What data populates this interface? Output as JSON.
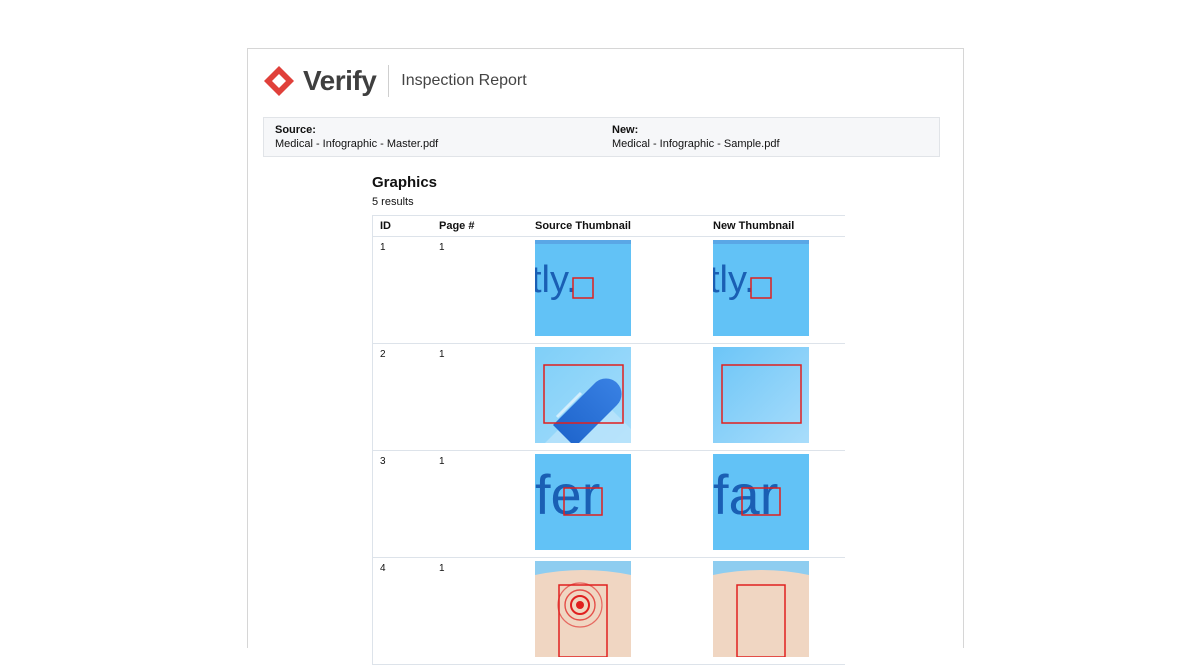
{
  "header": {
    "brand": "Verify",
    "report_title": "Inspection Report",
    "brand_color": "#e0403a"
  },
  "files": {
    "source_label": "Source:",
    "source_name": "Medical - Infographic - Master.pdf",
    "new_label": "New:",
    "new_name": "Medical - Infographic - Sample.pdf"
  },
  "section": {
    "title": "Graphics",
    "count": "5 results"
  },
  "table": {
    "columns": [
      "ID",
      "Page #",
      "Source Thumbnail",
      "New Thumbnail"
    ],
    "rows": [
      {
        "id": "1",
        "page": "1",
        "source_text": "tly.",
        "new_text": "tly."
      },
      {
        "id": "2",
        "page": "1",
        "source_text": "",
        "new_text": ""
      },
      {
        "id": "3",
        "page": "1",
        "source_text": "fer",
        "new_text": "far"
      },
      {
        "id": "4",
        "page": "1",
        "source_text": "",
        "new_text": ""
      }
    ]
  },
  "colors": {
    "thumb_blue": "#62c2f6",
    "text_blue": "#1a5fb4",
    "diff_red": "#e0201f",
    "skin": "#f0d6c2"
  }
}
